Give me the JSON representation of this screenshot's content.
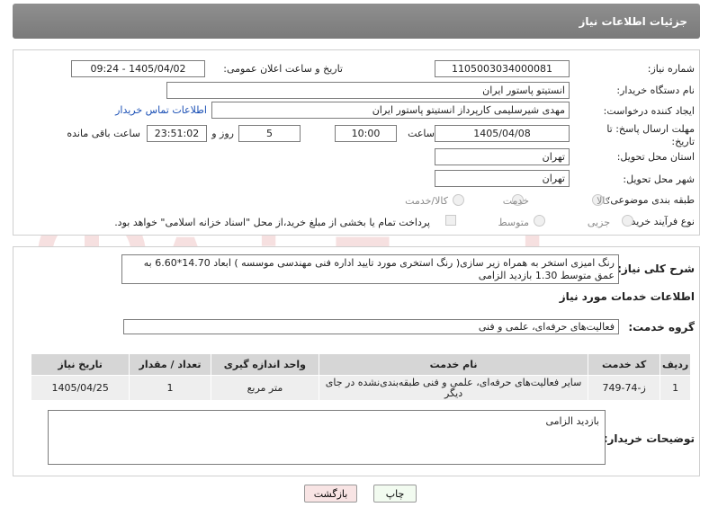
{
  "header": {
    "title": "جزئیات اطلاعات نیاز"
  },
  "fields": {
    "need_number_label": "شماره نیاز:",
    "need_number": "1105003034000081",
    "announce_label": "تاریخ و ساعت اعلان عمومی:",
    "announce_value": "1405/04/02 - 09:24",
    "buyer_label": "نام دستگاه خریدار:",
    "buyer_value": "انستیتو پاستور ایران",
    "creator_label": "ایجاد کننده درخواست:",
    "creator_value": "مهدی شیرسلیمی کارپرداز انستیتو پاستور ایران",
    "contact_link": "اطلاعات تماس خریدار",
    "deadline_label": "مهلت ارسال پاسخ: تا تاریخ:",
    "deadline_date": "1405/04/08",
    "time_label": "ساعت",
    "deadline_time": "10:00",
    "days_value": "5",
    "days_label": "روز و",
    "remaining_time": "23:51:02",
    "remaining_label": "ساعت باقی مانده",
    "province_label": "استان محل تحویل:",
    "province_value": "تهران",
    "city_label": "شهر محل تحویل:",
    "city_value": "تهران",
    "category_label": "طبقه بندی موضوعی:",
    "category_options": [
      "کالا",
      "خدمت",
      "کالا/خدمت"
    ],
    "process_label": "نوع فرآیند خرید :",
    "process_options": [
      "جزیی",
      "متوسط"
    ],
    "payment_note": "پرداخت تمام یا بخشی از مبلغ خرید،از محل \"اسناد خزانه اسلامی\" خواهد بود."
  },
  "description": {
    "label": "شرح کلی نیاز:",
    "text": "رنگ امیزی استخر به همراه زیر سازی( رنگ استخری مورد تایید اداره فنی مهندسی موسسه ) ابعاد 14.70*6.60 به عمق متوسط 1.30 بازدید الزامی"
  },
  "services": {
    "title": "اطلاعات خدمات مورد نیاز",
    "group_label": "گروه خدمت:",
    "group_value": "فعالیت‌های حرفه‌ای، علمی و فنی",
    "table": {
      "headers": [
        "ردیف",
        "کد خدمت",
        "نام خدمت",
        "واحد اندازه گیری",
        "تعداد / مقدار",
        "تاریخ نیاز"
      ],
      "rows": [
        [
          "1",
          "ز-74-749",
          "سایر فعالیت‌های حرفه‌ای، علمی و فنی طبقه‌بندی‌نشده در جای دیگر",
          "متر مربع",
          "1",
          "1405/04/25"
        ]
      ]
    }
  },
  "buyer_notes": {
    "label": "توضیحات خریدار:",
    "text": "بازدید الزامی"
  },
  "buttons": {
    "print": "چاپ",
    "back": "بازگشت"
  },
  "watermark": {
    "text": "AriaTender.net"
  },
  "colors": {
    "header_bg": "#878787",
    "link": "#1a4fb5",
    "back_button": "#f8e4e4",
    "table_head": "#d6d6d6"
  }
}
